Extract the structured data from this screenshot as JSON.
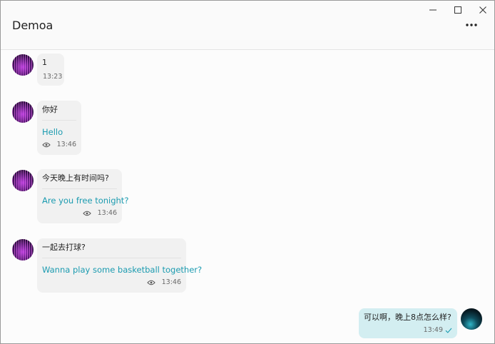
{
  "app": {
    "title": "Demoa"
  },
  "messages": [
    {
      "text": "1",
      "time": "13:23"
    },
    {
      "text": "你好",
      "translation": "Hello",
      "time": "13:46"
    },
    {
      "text": "今天晚上有时间吗?",
      "translation": "Are you free tonight?",
      "time": "13:46"
    },
    {
      "text": "一起去打球?",
      "translation": "Wanna play some basketball together?",
      "time": "13:46"
    },
    {
      "text": "可以啊，晚上8点怎么样?",
      "time": "13:49"
    }
  ],
  "icons": {
    "minimize": "minimize-icon",
    "maximize": "maximize-icon",
    "close": "close-icon",
    "more": "more-icon",
    "seen": "eye-icon",
    "sent": "check-icon"
  },
  "colors": {
    "translation": "#1b9bb0",
    "incoming_bubble": "#f1f1f1",
    "outgoing_bubble": "#d3eef1"
  }
}
